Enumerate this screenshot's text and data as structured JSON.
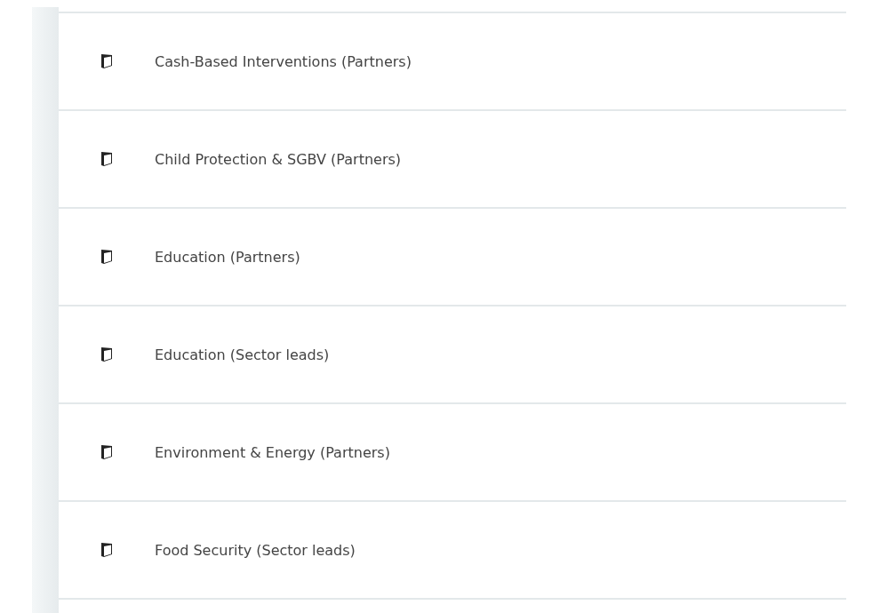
{
  "items": [
    {
      "label": "Cash-Based Interventions (Partners)"
    },
    {
      "label": "Child Protection & SGBV (Partners)"
    },
    {
      "label": "Education (Partners)"
    },
    {
      "label": "Education (Sector leads)"
    },
    {
      "label": "Environment & Energy (Partners)"
    },
    {
      "label": "Food Security (Sector leads)"
    }
  ]
}
